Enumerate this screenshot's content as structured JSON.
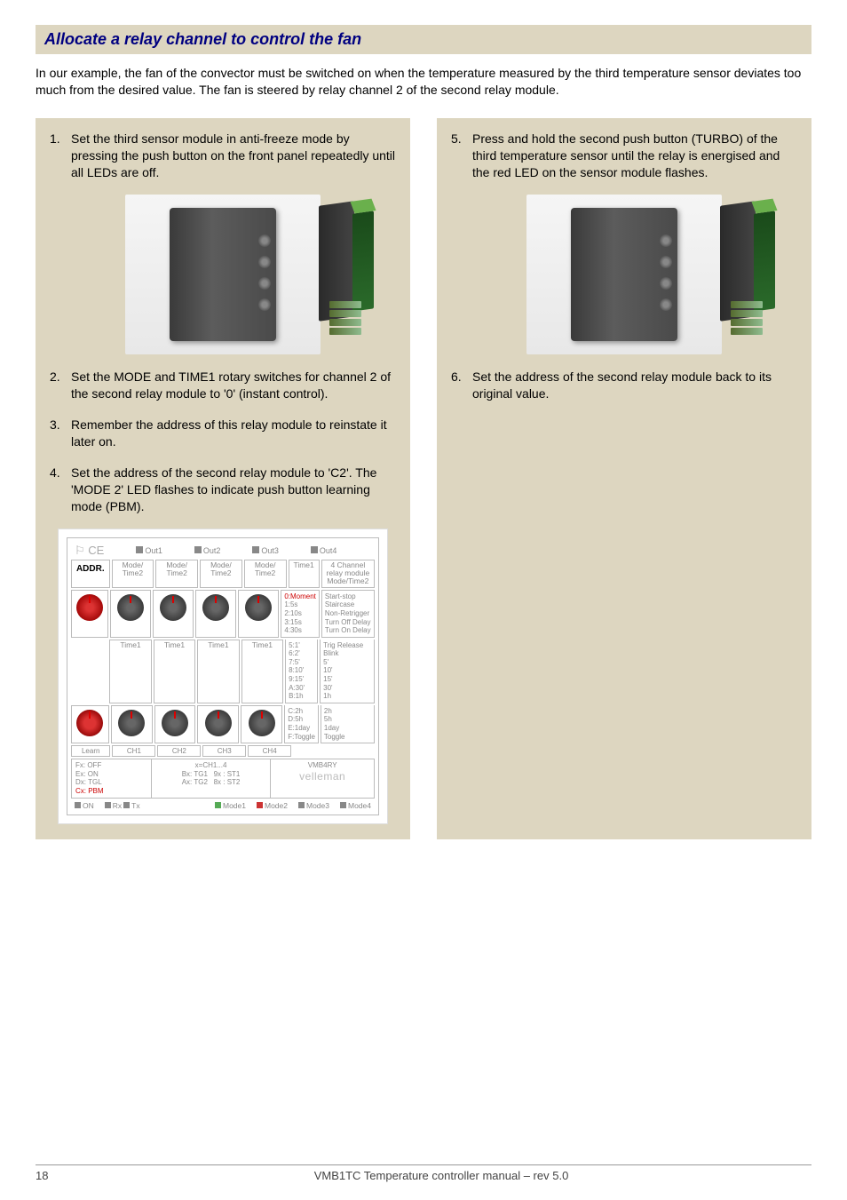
{
  "header": "Allocate a relay channel to control the fan",
  "intro": "In our example, the fan of the convector must be switched on when the temperature measured by the third temperature sensor deviates too much from the desired value. The fan is steered by relay channel 2 of the second relay module.",
  "left": {
    "step1": "Set the third sensor module in anti-freeze mode by pressing the push button on the front panel repeatedly until all LEDs are off.",
    "step2": "Set the MODE and TIME1 rotary switches for channel 2 of the second relay module to '0' (instant control).",
    "step3": "Remember the address of this relay module to reinstate it later on.",
    "step4": "Set the address of the second relay module to 'C2'. The 'MODE 2' LED flashes to indicate push button learning mode (PBM)."
  },
  "right": {
    "step5": "Press and hold the second push button (TURBO) of the third temperature sensor until the relay is energised and the red LED on the sensor module flashes.",
    "step6": "Set the address of the second relay module back to its original value."
  },
  "diagram": {
    "outs": [
      "Out1",
      "Out2",
      "Out3",
      "Out4"
    ],
    "addr": "ADDR.",
    "mode_time2": "Mode/\nTime2",
    "relay_module_label": "4 Channel relay module",
    "time1_header": "Time1",
    "mode_time2_header": "Mode/Time2",
    "time1": "Time1",
    "channels": [
      "CH1",
      "CH2",
      "CH3",
      "CH4"
    ],
    "learn": "Learn",
    "side_addr": [
      "Fx: OFF",
      "Ex: ON",
      "Dx: TGL",
      "Cx: PBM"
    ],
    "side_x": "x=CH1...4",
    "side_bx": "Bx: TG1",
    "side_ax": "Ax: TG2",
    "side_9x": "9x : ST1",
    "side_8x": "8x : ST2",
    "brand": "velleman",
    "model": "VMB4RY",
    "time_list": [
      "0:Moment",
      "1:5s",
      "2:10s",
      "3:15s",
      "4:30s",
      "5:1'",
      "6:2'",
      "7:5'",
      "8:10'",
      "9:15'",
      "A:30'",
      "B:1h",
      "C:2h",
      "D:5h",
      "E:1day",
      "F:Toggle"
    ],
    "mode_list": [
      "Start-stop",
      "Staircase",
      "Non-Retrigger",
      "Turn Off Delay",
      "Turn On Delay",
      "Trig Release",
      "Blink",
      "5'",
      "10'",
      "15'",
      "30'",
      "1h",
      "2h",
      "5h",
      "1day",
      "Toggle"
    ],
    "footer_labels": [
      "ON",
      "Rx",
      "Tx",
      "Mode1",
      "Mode2",
      "Mode3",
      "Mode4"
    ]
  },
  "footer": {
    "page": "18",
    "title": "VMB1TC Temperature controller manual – rev 5.0"
  }
}
